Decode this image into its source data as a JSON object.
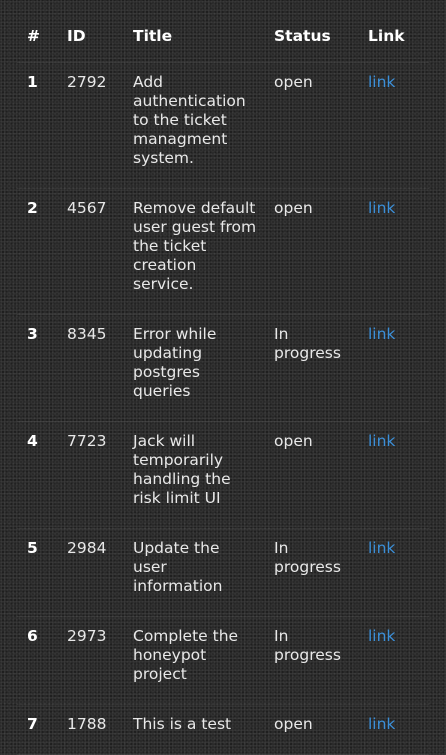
{
  "table": {
    "headers": {
      "num": "#",
      "id": "ID",
      "title": "Title",
      "status": "Status",
      "link": "Link"
    },
    "rows": [
      {
        "num": "1",
        "id": "2792",
        "title": "Add authentication to the ticket managment system.",
        "status": "open",
        "link": "link"
      },
      {
        "num": "2",
        "id": "4567",
        "title": "Remove default user guest from the ticket creation service.",
        "status": "open",
        "link": "link"
      },
      {
        "num": "3",
        "id": "8345",
        "title": "Error while updating postgres queries",
        "status": "In progress",
        "link": "link"
      },
      {
        "num": "4",
        "id": "7723",
        "title": "Jack will temporarily handling the risk limit UI",
        "status": "open",
        "link": "link"
      },
      {
        "num": "5",
        "id": "2984",
        "title": "Update the user information",
        "status": "In progress",
        "link": "link"
      },
      {
        "num": "6",
        "id": "2973",
        "title": "Complete the honeypot project",
        "status": "In progress",
        "link": "link"
      },
      {
        "num": "7",
        "id": "1788",
        "title": "This is a test",
        "status": "open",
        "link": "link"
      }
    ]
  },
  "colors": {
    "background": "#2a2a2a",
    "text": "#e6e6e6",
    "link": "#3b8fd8"
  }
}
